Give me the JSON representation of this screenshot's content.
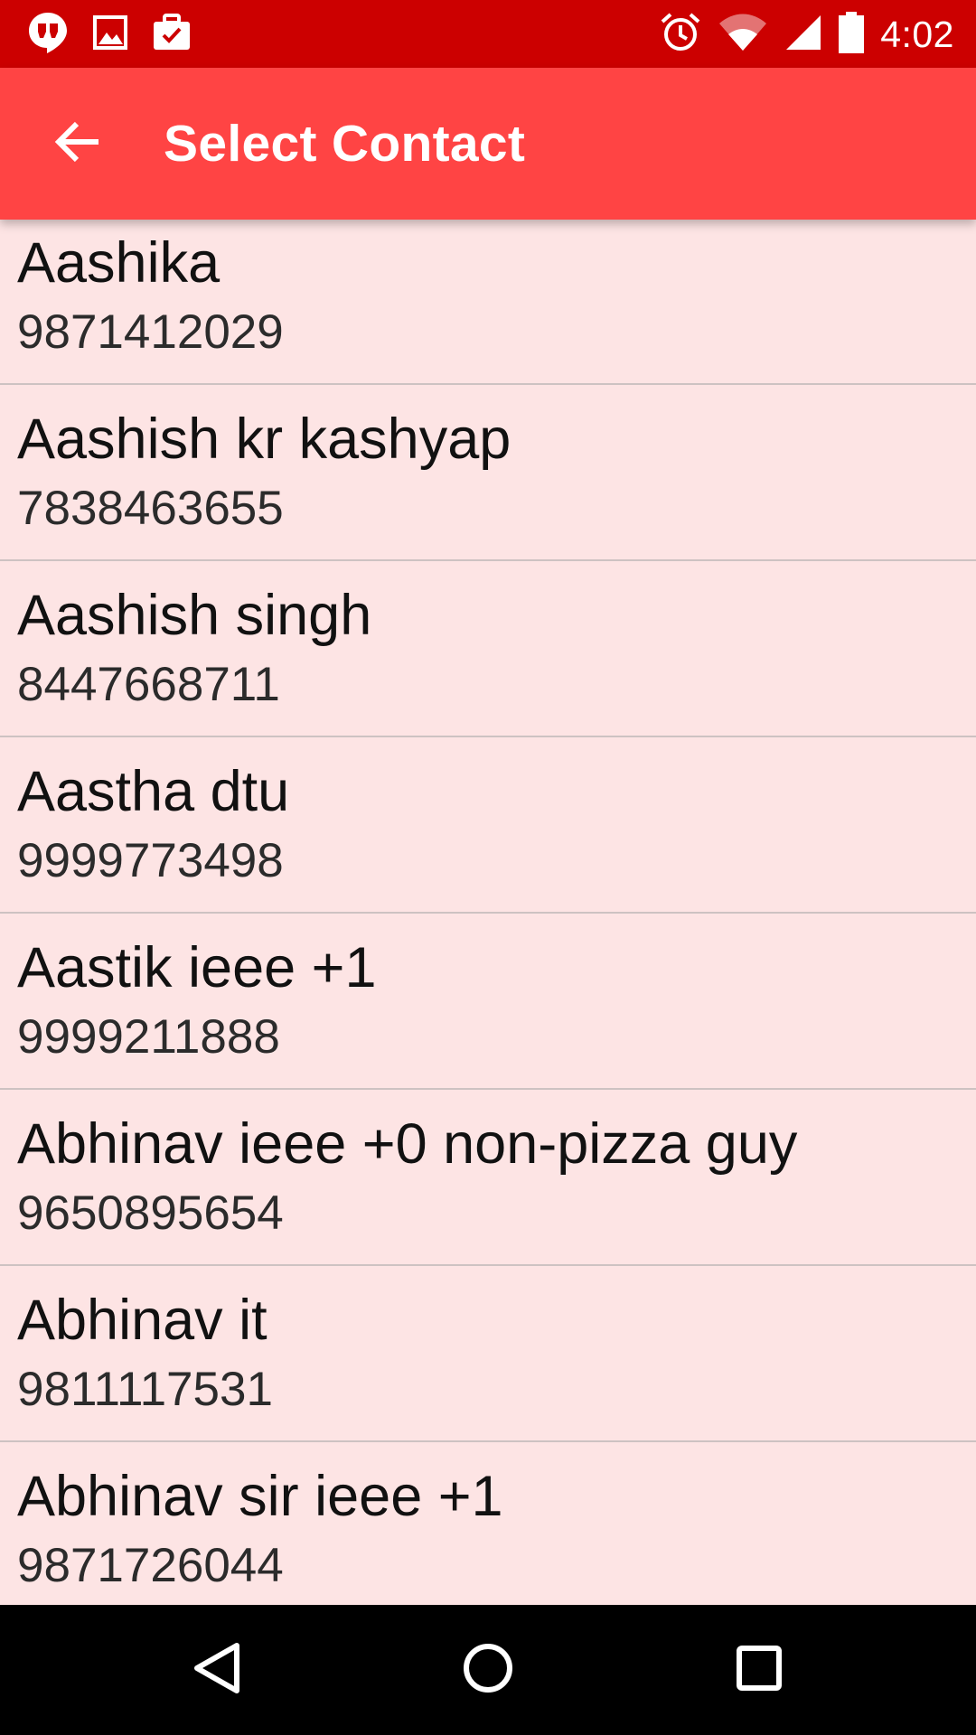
{
  "status_bar": {
    "time": "4:02",
    "left_icons": [
      "hangouts-icon",
      "image-icon",
      "briefcase-check-icon"
    ],
    "right_icons": [
      "alarm-icon",
      "wifi-icon",
      "signal-icon",
      "battery-icon"
    ]
  },
  "app_bar": {
    "title": "Select Contact",
    "back_icon": "arrow-back-icon",
    "color": "#ff4444"
  },
  "colors": {
    "status_bar": "#cc0000",
    "list_background": "#fde4e4",
    "divider": "#cdc2c2"
  },
  "contacts": [
    {
      "name": "Aashika",
      "number": "9871412029"
    },
    {
      "name": "Aashish kr kashyap",
      "number": "7838463655"
    },
    {
      "name": "Aashish singh",
      "number": "8447668711"
    },
    {
      "name": "Aastha dtu",
      "number": "9999773498"
    },
    {
      "name": "Aastik ieee +1",
      "number": "9999211888"
    },
    {
      "name": "Abhinav ieee +0 non-pizza guy",
      "number": "9650895654"
    },
    {
      "name": "Abhinav it",
      "number": "9811117531"
    },
    {
      "name": "Abhinav sir ieee +1",
      "number": "9871726044"
    }
  ],
  "nav_bar": {
    "buttons": [
      "back-triangle-icon",
      "home-circle-icon",
      "recents-square-icon"
    ]
  }
}
